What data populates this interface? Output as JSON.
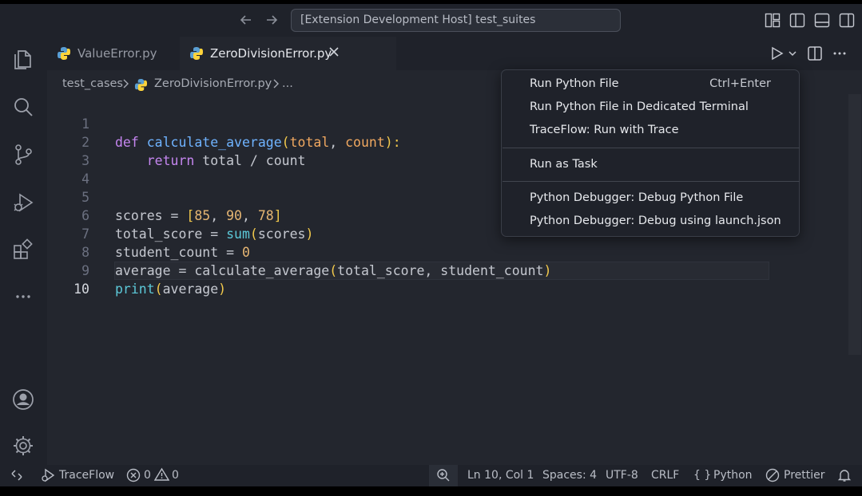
{
  "titlebar": {
    "command_center": "[Extension Development Host] test_suites"
  },
  "tabs": [
    {
      "label": "ValueError.py"
    },
    {
      "label": "ZeroDivisionError.py"
    }
  ],
  "breadcrumb": {
    "folder": "test_cases",
    "file": "ZeroDivisionError.py",
    "ellipsis": "..."
  },
  "editor": {
    "lines": [
      {
        "n": "1"
      },
      {
        "n": "2"
      },
      {
        "n": "3"
      },
      {
        "n": "4"
      },
      {
        "n": "5"
      },
      {
        "n": "6"
      },
      {
        "n": "7"
      },
      {
        "n": "8"
      },
      {
        "n": "9"
      },
      {
        "n": "10"
      }
    ],
    "tokens": {
      "l1_def": "def",
      "l1_fn": "calculate_average",
      "l1_open": "(",
      "l1_p1": "total",
      "l1_comma": ", ",
      "l1_p2": "count",
      "l1_close": "):",
      "l2_indent": "    ",
      "l2_ret": "return",
      "l2_rest": " total / count",
      "l5_a": "scores = ",
      "l5_open": "[",
      "l5_n1": "85",
      "l5_c1": ", ",
      "l5_n2": "90",
      "l5_c2": ", ",
      "l5_n3": "78",
      "l5_close": "]",
      "l6_a": "total_score = ",
      "l6_fn": "sum",
      "l6_open": "(",
      "l6_arg": "scores",
      "l6_close": ")",
      "l7_a": "student_count = ",
      "l7_n": "0",
      "l8_a": "average = calculate_average",
      "l8_open": "(",
      "l8_args": "total_score, student_count",
      "l8_close": ")",
      "l9_fn": "print",
      "l9_open": "(",
      "l9_arg": "average",
      "l9_close": ")"
    }
  },
  "run_menu": {
    "items": [
      {
        "label": "Run Python File",
        "shortcut": "Ctrl+Enter"
      },
      {
        "label": "Run Python File in Dedicated Terminal"
      },
      {
        "label": "TraceFlow: Run with Trace"
      },
      {
        "label": "Run as Task"
      },
      {
        "label": "Python Debugger: Debug Python File"
      },
      {
        "label": "Python Debugger: Debug using launch.json"
      }
    ]
  },
  "statusbar": {
    "traceflow": "TraceFlow",
    "errors": "0",
    "warnings": "0",
    "position": "Ln 10, Col 1",
    "spaces": "Spaces: 4",
    "encoding": "UTF-8",
    "eol": "CRLF",
    "language_braces": "{ }",
    "language": "Python",
    "formatter": "Prettier"
  },
  "colors": {
    "background": "#23262e",
    "chrome": "#1f222a",
    "keyword": "#c586f0",
    "function": "#6fb3ff",
    "parameter": "#f0a860",
    "number": "#e6b673"
  },
  "icons": [
    "back-arrow-icon",
    "forward-arrow-icon",
    "layout-icon",
    "sidebar-icon",
    "panel-icon",
    "secondary-sidebar-icon",
    "explorer-icon",
    "search-icon",
    "source-control-icon",
    "run-debug-icon",
    "extensions-icon",
    "more-icon",
    "account-icon",
    "settings-icon",
    "python-icon",
    "close-icon",
    "chevron-right-icon",
    "run-icon",
    "chevron-down-icon",
    "split-editor-icon",
    "ellipsis-icon",
    "remote-icon",
    "error-icon",
    "warning-icon",
    "zoom-icon",
    "no-entry-icon",
    "bell-icon"
  ]
}
